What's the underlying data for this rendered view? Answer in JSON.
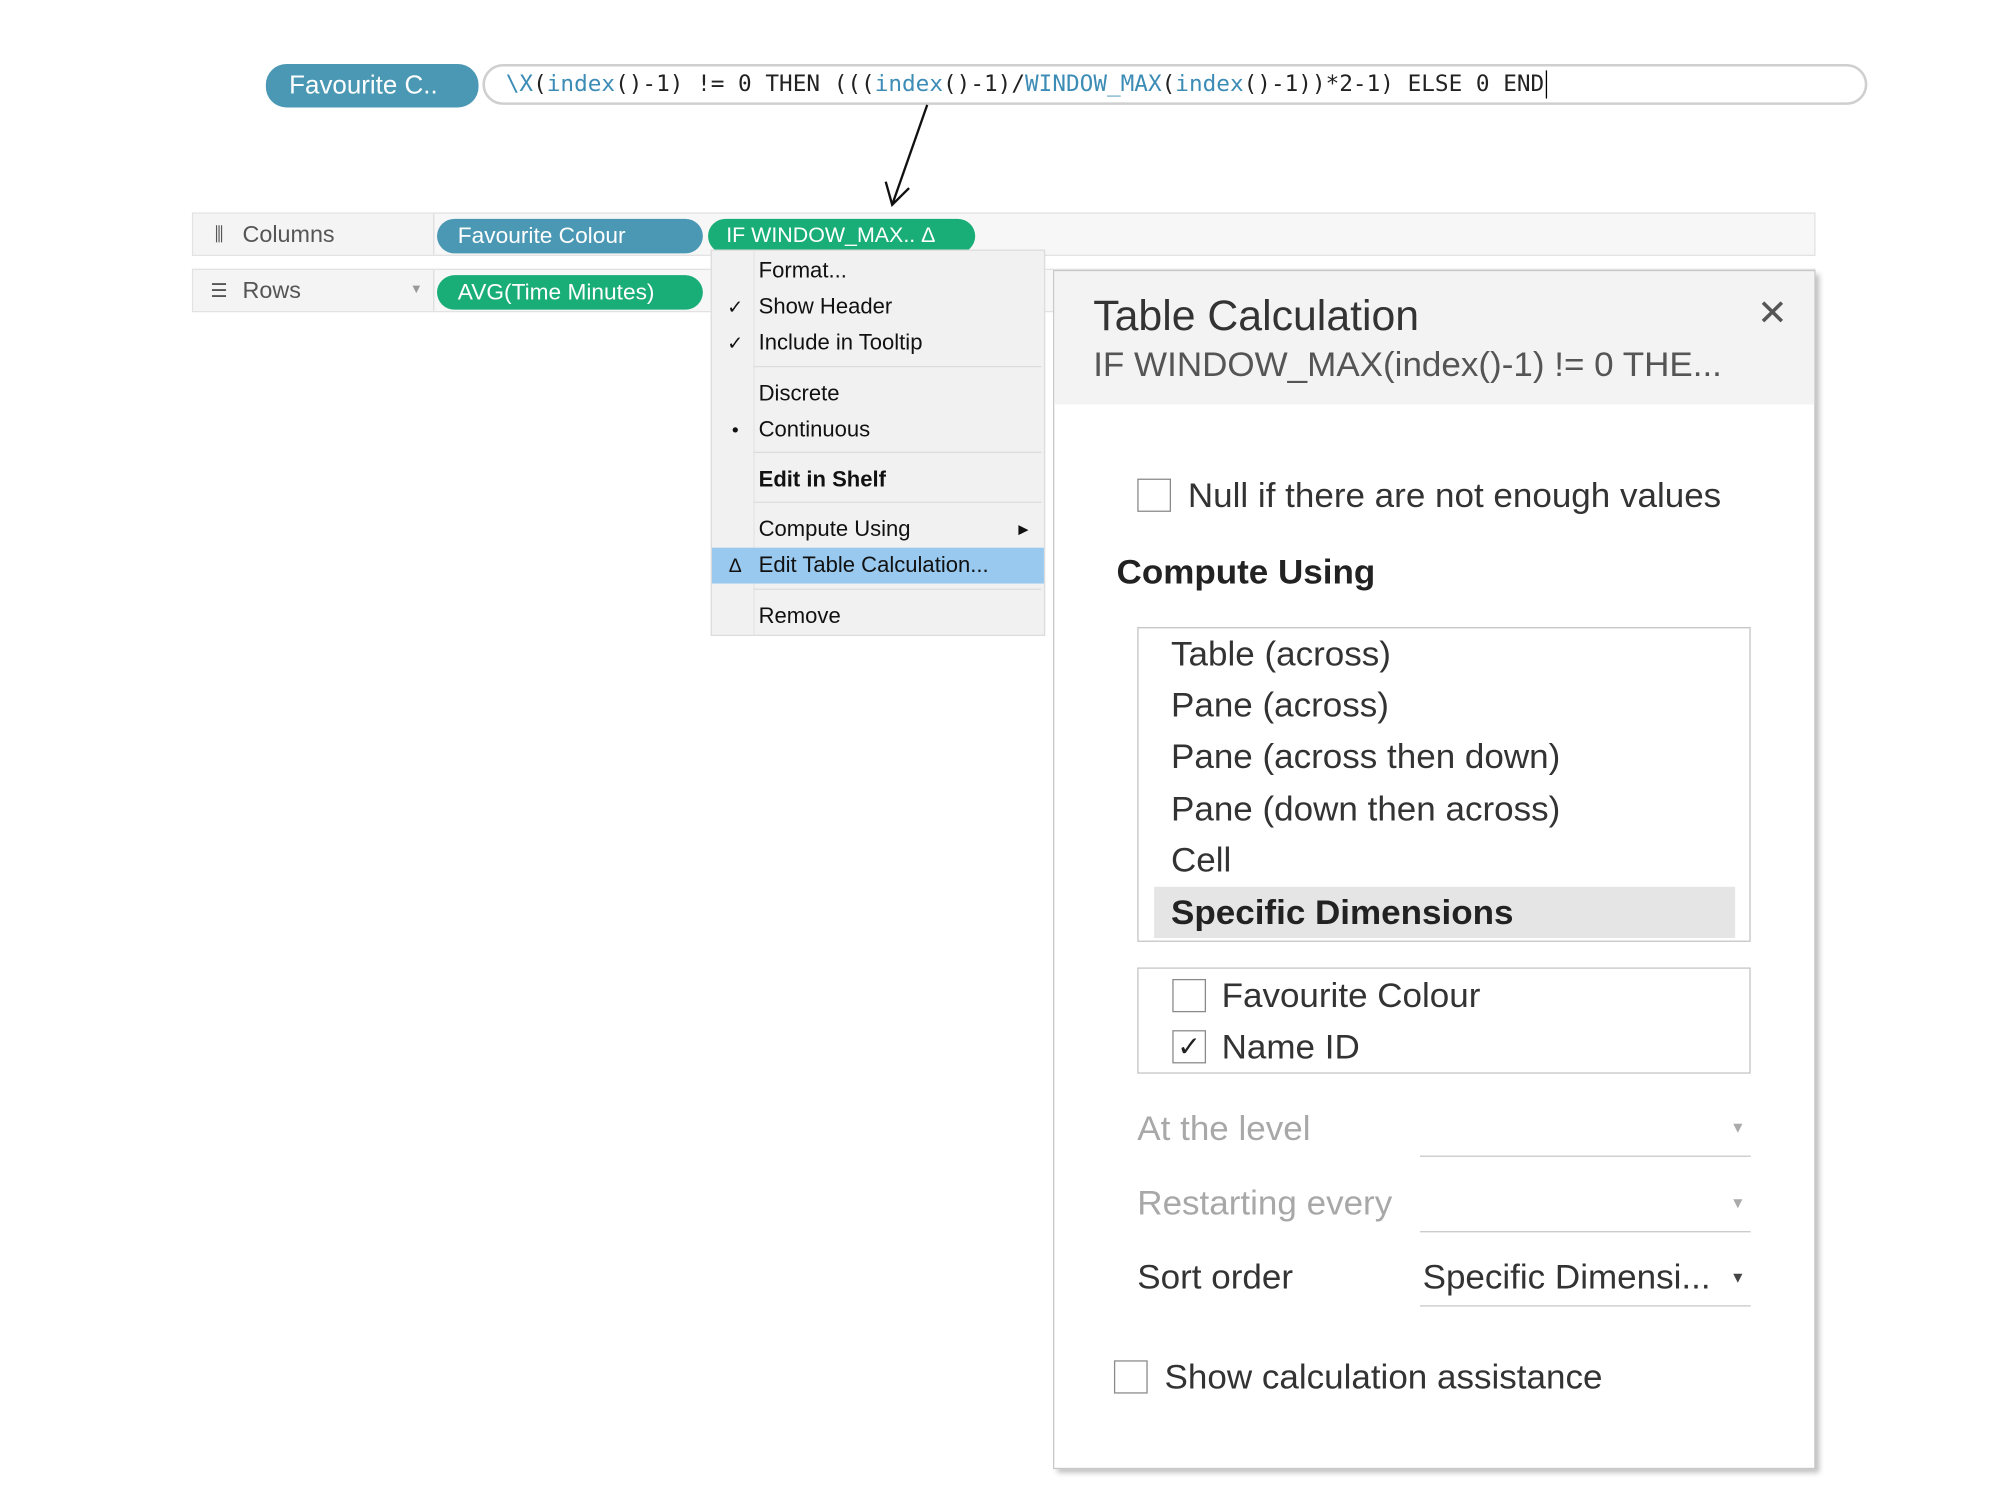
{
  "formula_bar": {
    "pill_label": "Favourite C..",
    "formula_parts": [
      {
        "text": "\\X",
        "fn": true
      },
      {
        "text": "(",
        "fn": false
      },
      {
        "text": "index",
        "fn": true
      },
      {
        "text": "()-1) != 0 THEN (((",
        "fn": false
      },
      {
        "text": "index",
        "fn": true
      },
      {
        "text": "()-1)/",
        "fn": false
      },
      {
        "text": "WINDOW_MAX",
        "fn": true
      },
      {
        "text": "(",
        "fn": false
      },
      {
        "text": "index",
        "fn": true
      },
      {
        "text": "()-1))*2-1) ELSE 0 END",
        "fn": false
      }
    ]
  },
  "shelves": {
    "columns": {
      "label": "Columns",
      "icon": "columns-icon",
      "pills": [
        "Favourite Colour",
        "IF WINDOW_MAX.. Δ"
      ]
    },
    "rows": {
      "label": "Rows",
      "icon": "rows-icon",
      "pills": [
        "AVG(Time Minutes)"
      ]
    }
  },
  "context_menu": {
    "items": [
      {
        "label": "Format...",
        "mark": "",
        "bold": false,
        "highlighted": false,
        "submenu": false
      },
      {
        "label": "Show Header",
        "mark": "✓",
        "bold": false,
        "highlighted": false,
        "submenu": false
      },
      {
        "label": "Include in Tooltip",
        "mark": "✓",
        "bold": false,
        "highlighted": false,
        "submenu": false
      },
      {
        "label": "Discrete",
        "mark": "",
        "bold": false,
        "highlighted": false,
        "submenu": false
      },
      {
        "label": "Continuous",
        "mark": "•",
        "bold": false,
        "highlighted": false,
        "submenu": false
      },
      {
        "label": "Edit in Shelf",
        "mark": "",
        "bold": true,
        "highlighted": false,
        "submenu": false
      },
      {
        "label": "Compute Using",
        "mark": "",
        "bold": false,
        "highlighted": false,
        "submenu": true
      },
      {
        "label": "Edit Table Calculation...",
        "mark": "Δ",
        "bold": false,
        "highlighted": true,
        "submenu": false
      },
      {
        "label": "Remove",
        "mark": "",
        "bold": false,
        "highlighted": false,
        "submenu": false
      }
    ]
  },
  "dialog": {
    "title": "Table Calculation",
    "subtitle": "IF WINDOW_MAX(index()-1) != 0 THE...",
    "close_icon": "close-icon",
    "null_if_label": "Null if there are not enough values",
    "null_if_checked": false,
    "compute_using_heading": "Compute Using",
    "compute_options": [
      {
        "label": "Table (across)",
        "selected": false
      },
      {
        "label": "Pane (across)",
        "selected": false
      },
      {
        "label": "Pane (across then down)",
        "selected": false
      },
      {
        "label": "Pane (down then across)",
        "selected": false
      },
      {
        "label": "Cell",
        "selected": false
      },
      {
        "label": "Specific Dimensions",
        "selected": true
      }
    ],
    "dimensions": [
      {
        "label": "Favourite Colour",
        "checked": false
      },
      {
        "label": "Name ID",
        "checked": true
      }
    ],
    "at_the_level": {
      "label": "At the level",
      "value": "",
      "enabled": false
    },
    "restarting_every": {
      "label": "Restarting every",
      "value": "",
      "enabled": false
    },
    "sort_order": {
      "label": "Sort order",
      "value": "Specific Dimensi...",
      "enabled": true
    },
    "show_assistance_label": "Show calculation assistance",
    "show_assistance_checked": false
  }
}
